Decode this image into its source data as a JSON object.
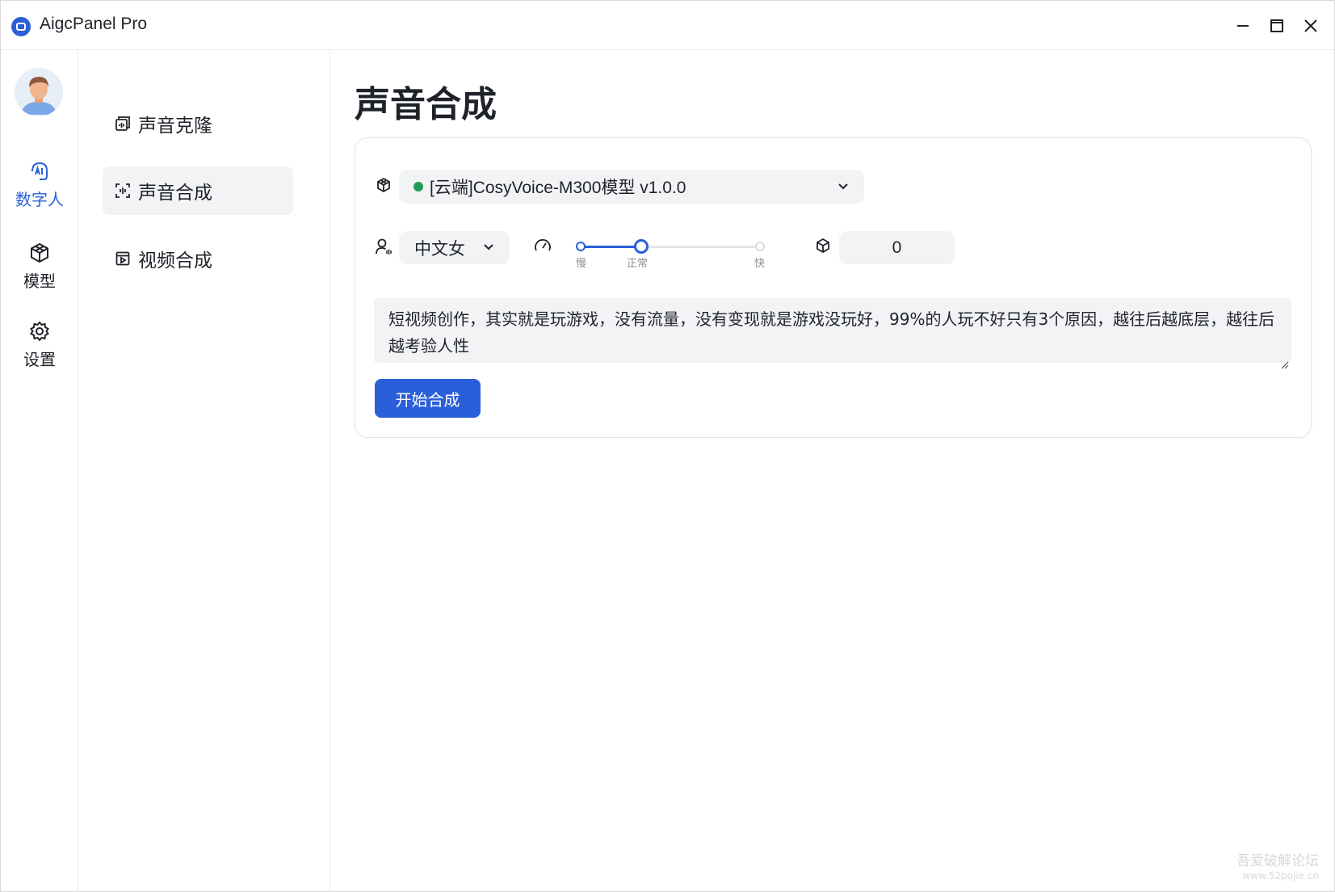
{
  "window": {
    "title": "AigcPanel Pro"
  },
  "rail": {
    "items": [
      {
        "label": "数字人",
        "icon": "ai-icon",
        "active": true
      },
      {
        "label": "模型",
        "icon": "cube-icon",
        "active": false
      },
      {
        "label": "设置",
        "icon": "gear-icon",
        "active": false
      }
    ]
  },
  "subnav": {
    "items": [
      {
        "label": "声音克隆",
        "icon": "voice-clone-icon",
        "active": false
      },
      {
        "label": "声音合成",
        "icon": "voice-synth-icon",
        "active": true
      },
      {
        "label": "视频合成",
        "icon": "video-synth-icon",
        "active": false
      }
    ]
  },
  "main": {
    "title": "声音合成",
    "model_select": {
      "value": "[云端]CosyVoice-M300模型 v1.0.0",
      "status_color": "#1f9d55"
    },
    "speaker_select": {
      "value": "中文女"
    },
    "speed": {
      "value_fraction": 0.33,
      "ticks": {
        "slow": "慢",
        "normal": "正常",
        "fast": "快"
      }
    },
    "seed": {
      "value": "0"
    },
    "text": {
      "value": "短视频创作，其实就是玩游戏，没有流量，没有变现就是游戏没玩好，99%的人玩不好只有3个原因，越往后越底层，越往后越考验人性"
    },
    "start_button": "开始合成"
  },
  "watermark": {
    "line1": "吾爱破解论坛",
    "line2": "www.52pojie.cn"
  },
  "colors": {
    "accent": "#2b5fd9",
    "input_bg": "#f2f3f5"
  }
}
